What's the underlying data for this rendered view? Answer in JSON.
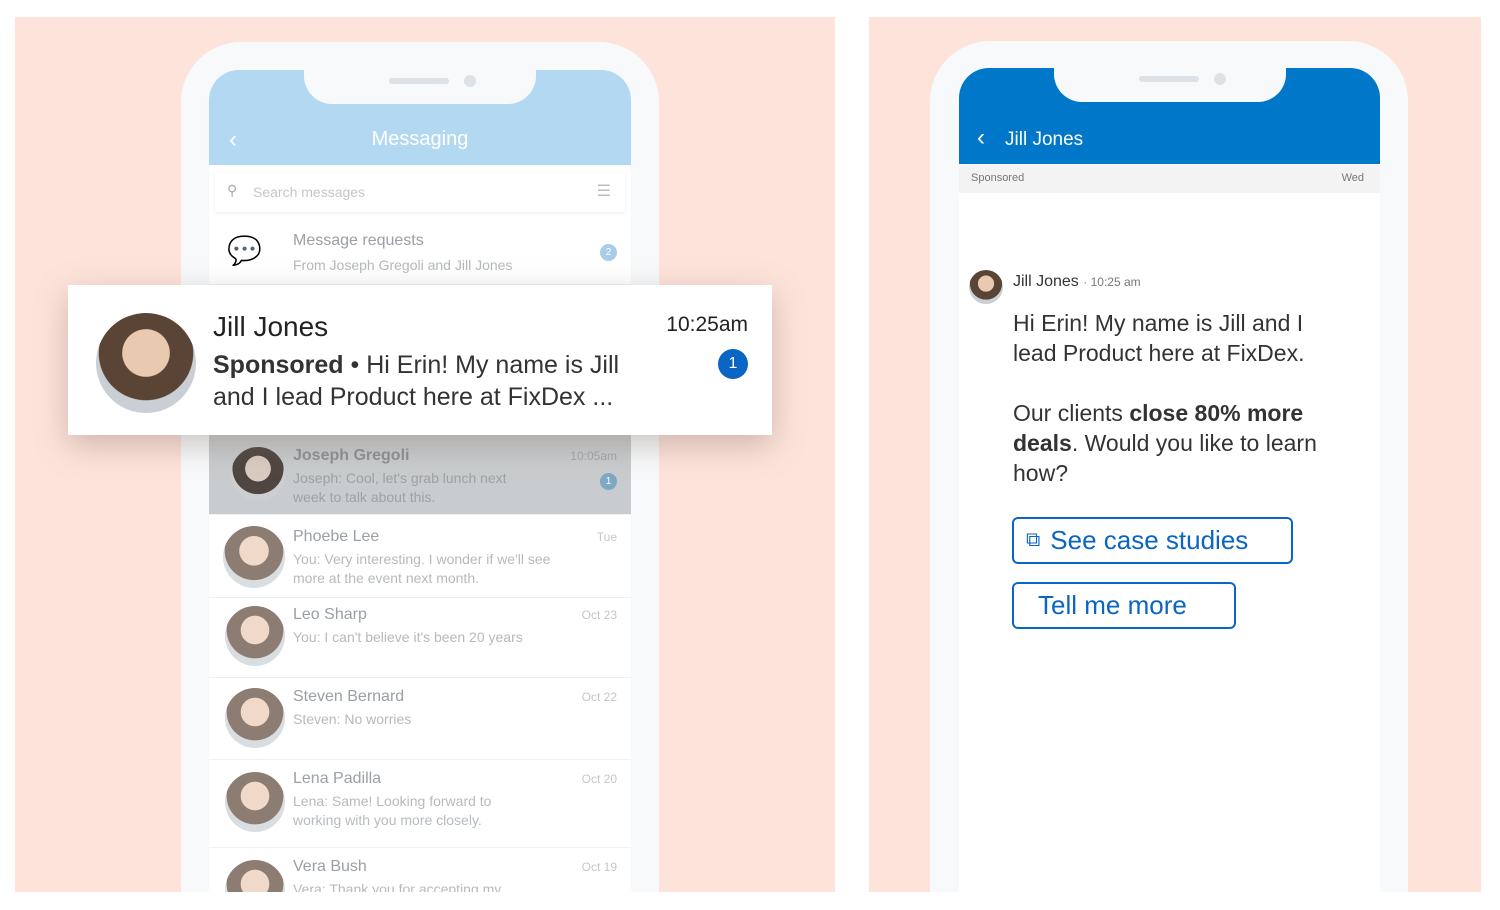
{
  "left": {
    "header_title": "Messaging",
    "search_placeholder": "Search messages",
    "requests": {
      "title": "Message requests",
      "subtitle": "From Joseph Gregoli and Jill Jones",
      "badge": "2"
    },
    "highlight": {
      "name": "Jill Jones",
      "sponsored": "Sponsored",
      "bullet": "•",
      "preview_line1": "Hi Erin! My name is Jill",
      "preview_line2": "and I lead Product here at FixDex ...",
      "time": "10:25am",
      "badge": "1"
    },
    "conversations": [
      {
        "name": "Joseph Gregoli",
        "preview": "Joseph: Cool, let's grab lunch next week to talk about this.",
        "time": "10:05am",
        "badge": "1"
      },
      {
        "name": "Phoebe Lee",
        "preview": "You: Very interesting. I wonder if we'll see more at the event next month.",
        "time": "Tue"
      },
      {
        "name": "Leo Sharp",
        "preview": "You: I can't believe it's been 20 years",
        "time": "Oct 23"
      },
      {
        "name": "Steven Bernard",
        "preview": "Steven: No worries",
        "time": "Oct 22"
      },
      {
        "name": "Lena Padilla",
        "preview": "Lena: Same! Looking forward to working with you more closely.",
        "time": "Oct 20"
      },
      {
        "name": "Vera Bush",
        "preview": "Vera: Thank you for accepting my connection request",
        "time": "Oct 19"
      }
    ]
  },
  "right": {
    "header_title": "Jill Jones",
    "sponsored_label": "Sponsored",
    "day": "Wed",
    "sender": "Jill Jones",
    "sent_time": "· 10:25 am",
    "msg1": "Hi Erin! My name is Jill and I lead Product here at FixDex.",
    "msg2_pre": "Our clients ",
    "msg2_bold": "close 80% more deals",
    "msg2_post": ". Would you like to learn how?",
    "cta1": "See case studies",
    "cta2": "Tell me more"
  },
  "colors": {
    "background": "#fde3da",
    "brand_blue": "#0077c8",
    "light_blue": "#b3d8f2",
    "badge": "#0a66c2"
  }
}
